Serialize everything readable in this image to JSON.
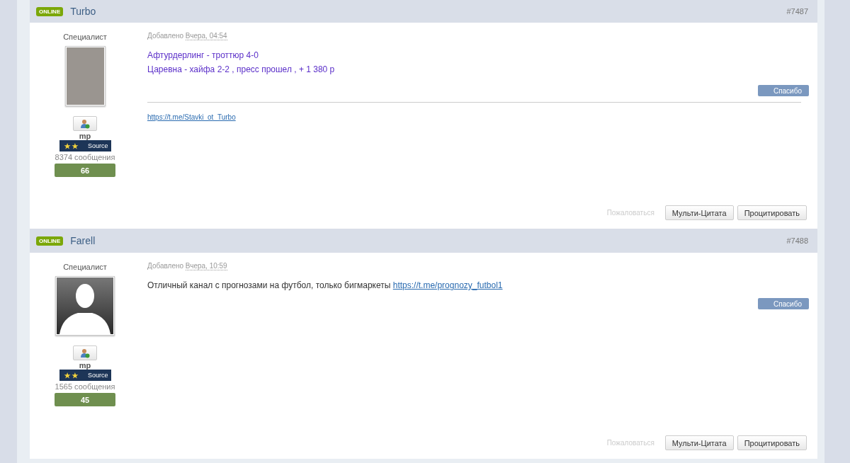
{
  "posts": [
    {
      "online_badge": "ONLINE",
      "author": "Turbo",
      "number": "#7487",
      "group": "Специалист",
      "avatar": {
        "kind": "photo"
      },
      "username": "mp",
      "rank": "Source",
      "post_count": "8374 сообщения",
      "reputation": "66",
      "date_label": "Добавлено",
      "date": "Вчера, 04:54",
      "lines": [
        {
          "kind": "colored",
          "text": "Афтурдерлинг - троттюр 4-0"
        },
        {
          "kind": "colored",
          "text": "Царевна - хайфа 2-2 , пресс прошел , + 1 380 р"
        }
      ],
      "thanks_button": "Спасибо",
      "signature_link": "https://t.me/Stavki_ot_Turbo",
      "report": "Пожаловаться",
      "multiquote_button": "Мульти-Цитата",
      "quote_button": "Процитировать"
    },
    {
      "online_badge": "ONLINE",
      "author": "Farell",
      "number": "#7488",
      "group": "Специалист",
      "avatar": {
        "kind": "silhouette"
      },
      "username": "mp",
      "rank": "Source",
      "post_count": "1565 сообщения",
      "reputation": "45",
      "date_label": "Добавлено",
      "date": "Вчера, 10:59",
      "lines": [
        {
          "kind": "plain",
          "text": "Отличный канал с прогнозами на футбол, только бигмаркеты",
          "link": "https://t.me/prognozy_futbol1"
        }
      ],
      "thanks_button": "Спасибо",
      "report": "Пожаловаться",
      "multiquote_button": "Мульти-Цитата",
      "quote_button": "Процитировать"
    }
  ]
}
